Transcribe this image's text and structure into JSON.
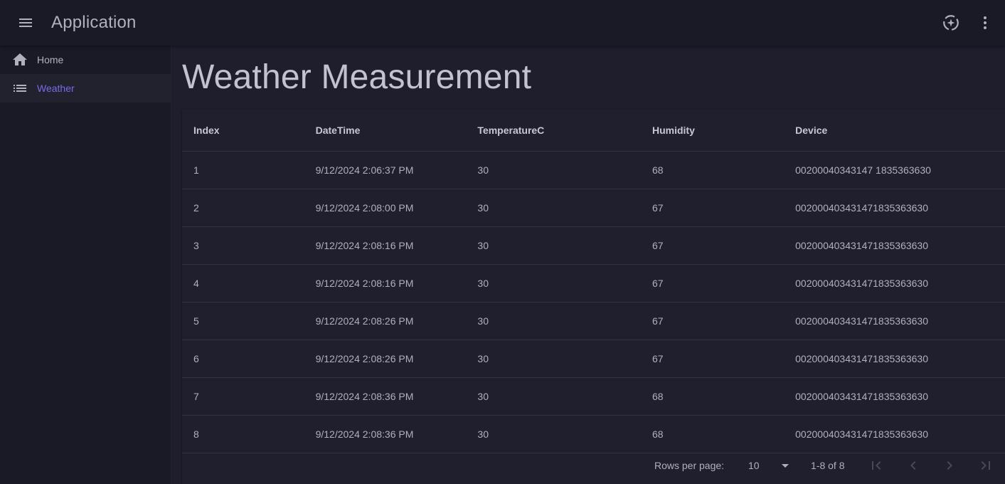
{
  "app": {
    "title": "Application"
  },
  "appbar": {
    "icons": [
      "menu-icon",
      "theme-toggle-icon",
      "more-vert-icon"
    ]
  },
  "nav": {
    "items": [
      {
        "label": "Home",
        "icon": "home-icon",
        "active": false
      },
      {
        "label": "Weather",
        "icon": "list-icon",
        "active": true
      }
    ]
  },
  "page": {
    "title": "Weather Measurement"
  },
  "table": {
    "columns": [
      "Index",
      "DateTime",
      "TemperatureC",
      "Humidity",
      "Device"
    ],
    "rows": [
      [
        "1",
        "9/12/2024 2:06:37 PM",
        "30",
        "68",
        "00200040343147 1835363630"
      ],
      [
        "2",
        "9/12/2024 2:08:00 PM",
        "30",
        "67",
        "002000403431471835363630"
      ],
      [
        "3",
        "9/12/2024 2:08:16 PM",
        "30",
        "67",
        "002000403431471835363630"
      ],
      [
        "4",
        "9/12/2024 2:08:16 PM",
        "30",
        "67",
        "002000403431471835363630"
      ],
      [
        "5",
        "9/12/2024 2:08:26 PM",
        "30",
        "67",
        "002000403431471835363630"
      ],
      [
        "6",
        "9/12/2024 2:08:26 PM",
        "30",
        "67",
        "002000403431471835363630"
      ],
      [
        "7",
        "9/12/2024 2:08:36 PM",
        "30",
        "68",
        "002000403431471835363630"
      ],
      [
        "8",
        "9/12/2024 2:08:36 PM",
        "30",
        "68",
        "002000403431471835363630"
      ]
    ]
  },
  "pagination": {
    "rows_per_page_label": "Rows per page:",
    "rows_per_page_value": "10",
    "range": "1-8 of 8"
  },
  "colors": {
    "background": "#1a1a27",
    "surface": "#1e1e2d",
    "accent": "#776be7",
    "text": "#b2b0bf"
  }
}
